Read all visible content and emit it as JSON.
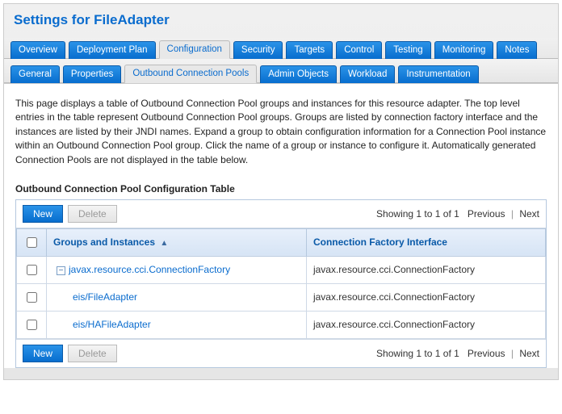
{
  "heading": "Settings for FileAdapter",
  "tabs": [
    {
      "label": "Overview",
      "selected": false
    },
    {
      "label": "Deployment Plan",
      "selected": false
    },
    {
      "label": "Configuration",
      "selected": true
    },
    {
      "label": "Security",
      "selected": false
    },
    {
      "label": "Targets",
      "selected": false
    },
    {
      "label": "Control",
      "selected": false
    },
    {
      "label": "Testing",
      "selected": false
    },
    {
      "label": "Monitoring",
      "selected": false
    },
    {
      "label": "Notes",
      "selected": false
    }
  ],
  "subtabs": [
    {
      "label": "General",
      "selected": false
    },
    {
      "label": "Properties",
      "selected": false
    },
    {
      "label": "Outbound Connection Pools",
      "selected": true
    },
    {
      "label": "Admin Objects",
      "selected": false
    },
    {
      "label": "Workload",
      "selected": false
    },
    {
      "label": "Instrumentation",
      "selected": false
    }
  ],
  "description": "This page displays a table of Outbound Connection Pool groups and instances for this resource adapter. The top level entries in the table represent Outbound Connection Pool groups. Groups are listed by connection factory interface and the instances are listed by their JNDI names. Expand a group to obtain configuration information for a Connection Pool instance within an Outbound Connection Pool group. Click the name of a group or instance to configure it. Automatically generated Connection Pools are not displayed in the table below.",
  "section_title": "Outbound Connection Pool Configuration Table",
  "table": {
    "buttons": {
      "new": "New",
      "delete": "Delete"
    },
    "pager": {
      "showing": "Showing 1 to 1 of 1",
      "prev": "Previous",
      "next": "Next"
    },
    "columns": {
      "groups": "Groups and Instances",
      "factory": "Connection Factory Interface"
    },
    "rows": [
      {
        "indent": 0,
        "expand": "−",
        "name": "javax.resource.cci.ConnectionFactory",
        "factory": "javax.resource.cci.ConnectionFactory"
      },
      {
        "indent": 1,
        "expand": "",
        "name": "eis/FileAdapter",
        "factory": "javax.resource.cci.ConnectionFactory"
      },
      {
        "indent": 1,
        "expand": "",
        "name": "eis/HAFileAdapter",
        "factory": "javax.resource.cci.ConnectionFactory"
      }
    ]
  }
}
